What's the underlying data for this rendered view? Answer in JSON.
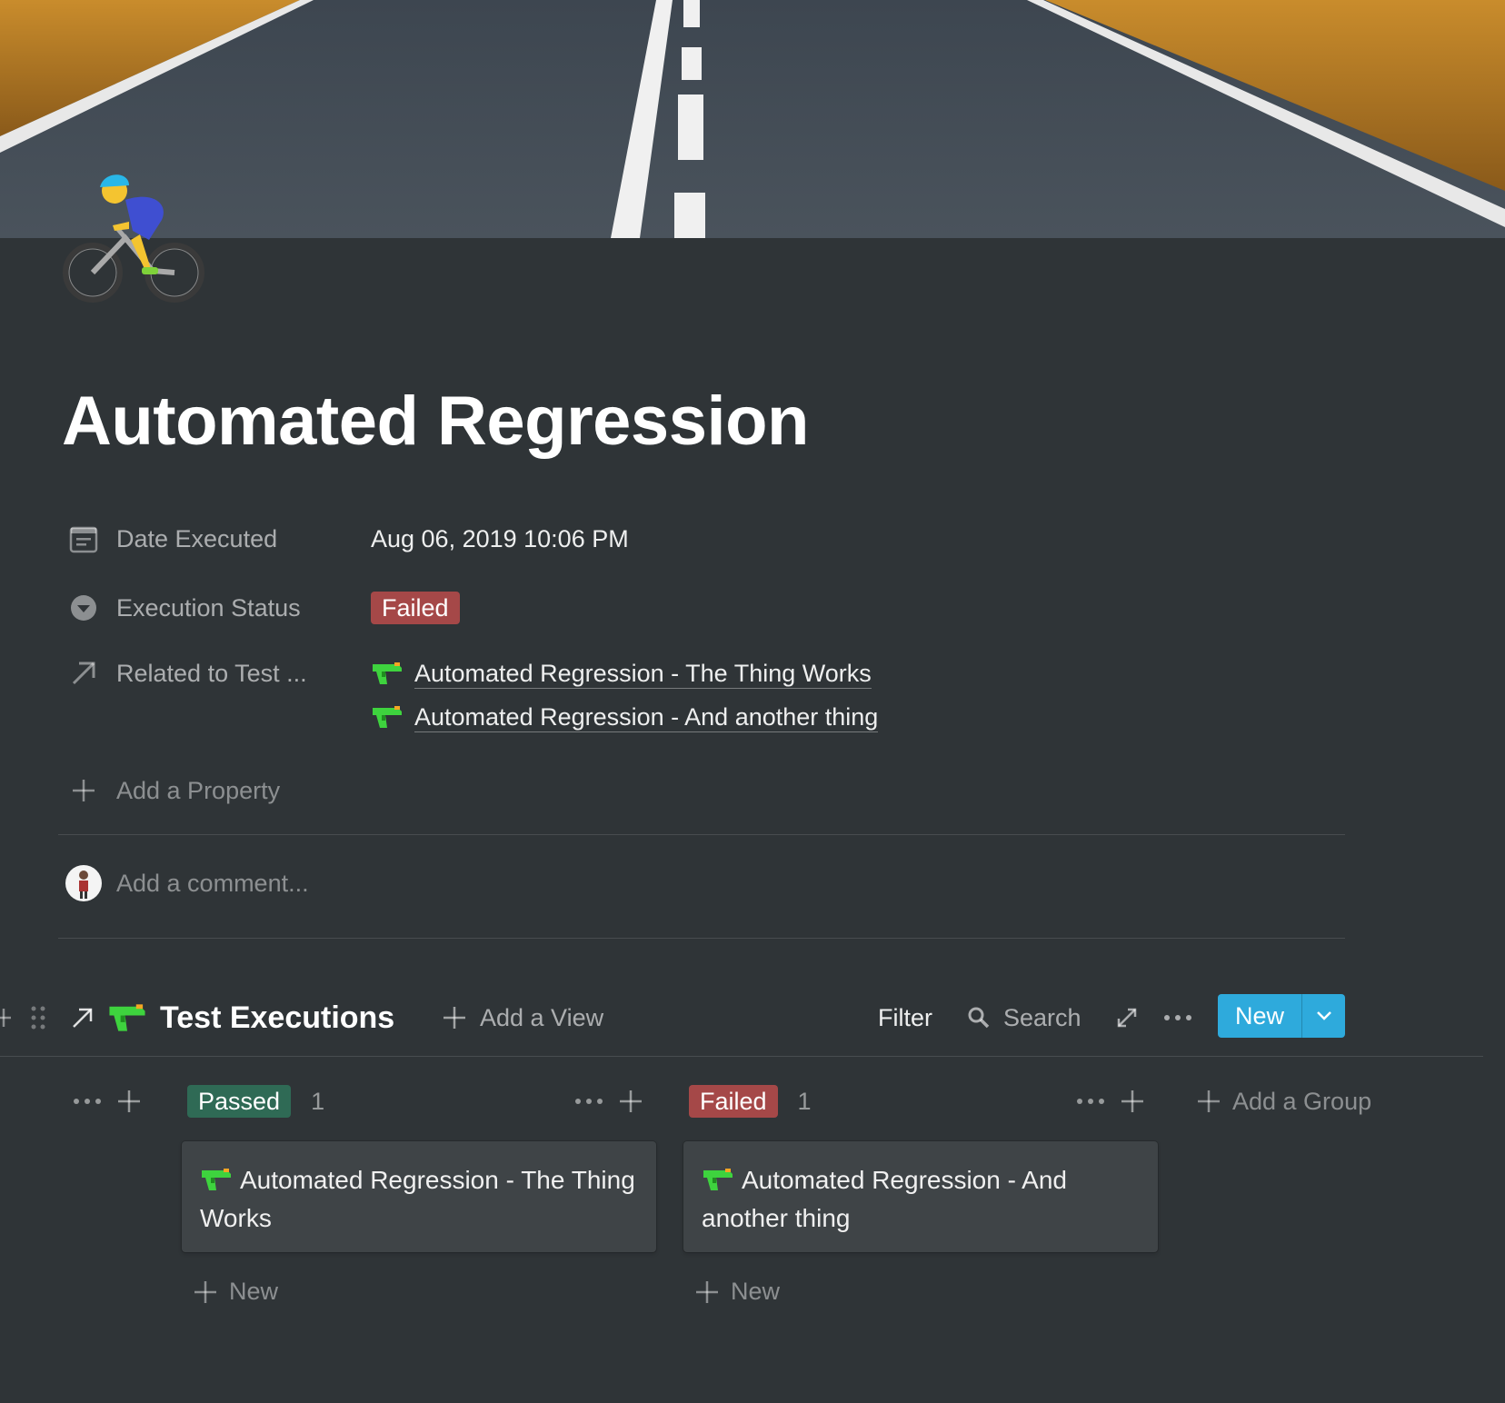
{
  "page": {
    "title": "Automated Regression",
    "icon": "cyclist-emoji-icon"
  },
  "properties": {
    "date_executed": {
      "label": "Date Executed",
      "value": "Aug 06, 2019 10:06 PM",
      "icon": "calendar-icon"
    },
    "execution_status": {
      "label": "Execution Status",
      "value": "Failed",
      "icon": "chevron-circle-icon",
      "color": "#a54848"
    },
    "related": {
      "label": "Related to Test ...",
      "icon": "arrow-up-right-icon",
      "items": [
        "Automated Regression - The Thing Works",
        "Automated Regression - And another thing"
      ]
    },
    "add_property_label": "Add a Property"
  },
  "comment": {
    "placeholder": "Add a comment..."
  },
  "database": {
    "title": "Test Executions",
    "add_view_label": "Add a View",
    "filter_label": "Filter",
    "search_label": "Search",
    "new_label": "New",
    "accent": "#2eaadc"
  },
  "board": {
    "groups": [
      {
        "label": "Passed",
        "count": "1",
        "color": "#2f6a55",
        "cards": [
          "Automated Regression - The Thing Works"
        ],
        "new_label": "New"
      },
      {
        "label": "Failed",
        "count": "1",
        "color": "#a54848",
        "cards": [
          "Automated Regression - And another thing"
        ],
        "new_label": "New"
      }
    ],
    "add_group_label": "Add a Group"
  }
}
